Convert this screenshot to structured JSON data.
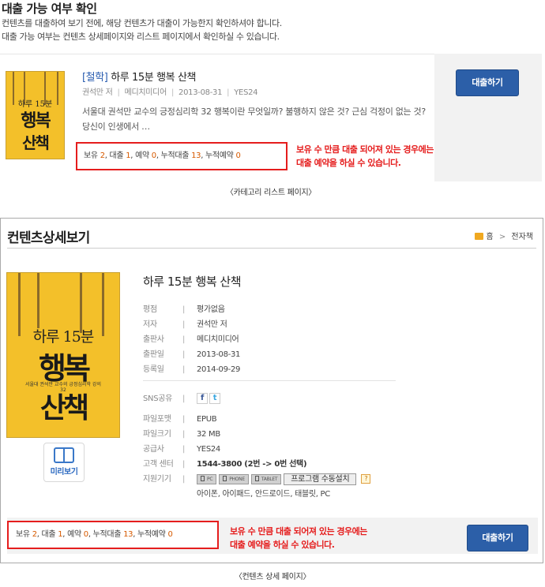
{
  "page": {
    "title": "대출 가능 여부 확인",
    "intro_line1": "컨텐츠를 대출하여 보기 전에, 해당 컨텐츠가 대출이 가능한지 확인하셔야 합니다.",
    "intro_line2": "대출 가능 여부는 컨텐츠 상세페이지와 리스트 페이지에서 확인하실 수 있습니다."
  },
  "list": {
    "category": "[철학]",
    "book_title": "하루 15분 행복 산책",
    "author": "권석만 저",
    "publisher": "메디치미디어",
    "date": "2013-08-31",
    "vendor": "YES24",
    "description": "서울대 권석만 교수의 긍정심리학 32 행복이란 무엇일까? 불행하지 않은 것? 근심 걱정이 없는 것? 당신이 인생에서 …",
    "borrow_button": "대출하기",
    "caption": "〈카테고리 리스트 페이지〉",
    "cover": {
      "line1": "하루 15분",
      "line2": "행복",
      "line3": "산책"
    }
  },
  "status": {
    "own_label": "보유",
    "own": "2",
    "loan_label": "대출",
    "loan": "1",
    "reserve_label": "예약",
    "reserve": "0",
    "total_loan_label": "누적대출",
    "total_loan": "13",
    "total_reserve_label": "누적예약",
    "total_reserve": "0"
  },
  "note": {
    "line1": "보유 수 만큼 대출 되어져 있는 경우에는",
    "line2": "대출 예약을 하실 수 있습니다."
  },
  "detail": {
    "header": "컨텐츠상세보기",
    "crumb_home": "홈",
    "crumb_arrow": ">",
    "crumb_current": "전자책",
    "book_title": "하루 15분 행복 산책",
    "cover": {
      "line1": "하루 15분",
      "line2": "행복",
      "line3": "산책",
      "sub": "서울대 권석만 교수의 긍정심리학 강의 32"
    },
    "preview_label": "미리보기",
    "fields": {
      "rating_k": "평점",
      "rating_v": "평가없음",
      "author_k": "저자",
      "author_v": "권석만 저",
      "publisher_k": "출판사",
      "publisher_v": "메디치미디어",
      "pubdate_k": "출판일",
      "pubdate_v": "2013-08-31",
      "regdate_k": "등록일",
      "regdate_v": "2014-09-29",
      "sns_k": "SNS공유",
      "format_k": "파일포맷",
      "format_v": "EPUB",
      "size_k": "파일크기",
      "size_v": "32 MB",
      "supplier_k": "공급사",
      "supplier_v": "YES24",
      "support_k": "고객 센터",
      "support_v": "1544-3800 (2번 -> 0번 선택)",
      "device_k": "지원기기",
      "devices": {
        "pc": "PC",
        "phone": "PHONE",
        "tablet": "TABLET"
      },
      "install_label": "프로그램 수동설치",
      "help_label": "?",
      "devices_text": "아이폰, 아이패드, 안드로이드, 태블릿, PC"
    },
    "borrow_button": "대출하기",
    "caption": "〈컨텐츠 상세 페이지〉"
  },
  "colors": {
    "accent": "#2c5fa8",
    "highlight": "#e51d1d",
    "number": "#d65a00"
  }
}
